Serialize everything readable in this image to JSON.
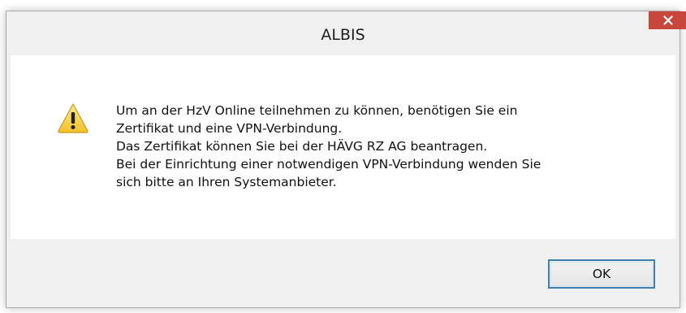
{
  "window": {
    "title": "ALBIS",
    "close_icon": "close-icon",
    "close_color": "#c9473a"
  },
  "message": {
    "icon": "warning-icon",
    "lines": [
      "Um an der HzV Online teilnehmen zu können, benötigen Sie ein",
      "Zertifikat und eine VPN-Verbindung.",
      "Das Zertifikat können Sie bei der HÄVG RZ AG beantragen.",
      "Bei der Einrichtung einer notwendigen VPN-Verbindung wenden Sie",
      "sich bitte an Ihren Systemanbieter."
    ]
  },
  "buttons": {
    "ok_label": "OK"
  }
}
